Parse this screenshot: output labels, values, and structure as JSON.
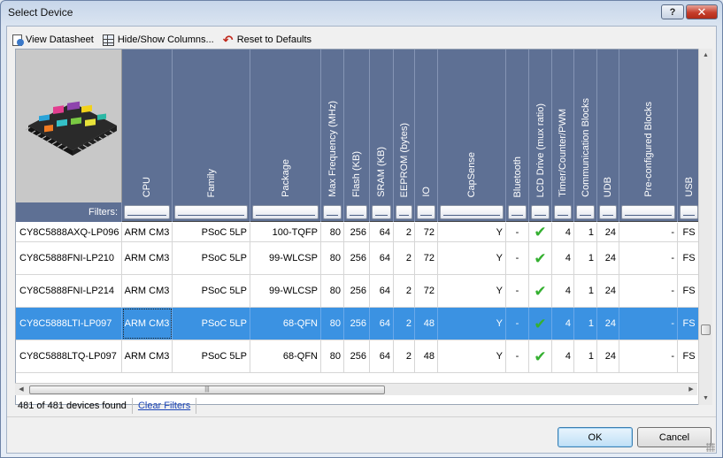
{
  "window": {
    "title": "Select Device",
    "help_label": "?",
    "close_label": "✕"
  },
  "toolbar": {
    "view_datasheet": "View Datasheet",
    "hide_show_columns": "Hide/Show Columns...",
    "reset_defaults": "Reset to Defaults"
  },
  "filters_label": "Filters:",
  "columns": [
    {
      "key": "cpu",
      "label": "CPU"
    },
    {
      "key": "family",
      "label": "Family"
    },
    {
      "key": "package",
      "label": "Package"
    },
    {
      "key": "max_freq",
      "label": "Max Frequency (MHz)"
    },
    {
      "key": "flash",
      "label": "Flash (KB)"
    },
    {
      "key": "sram",
      "label": "SRAM (KB)"
    },
    {
      "key": "eeprom",
      "label": "EEPROM (bytes)"
    },
    {
      "key": "io",
      "label": "IO"
    },
    {
      "key": "capsense",
      "label": "CapSense"
    },
    {
      "key": "bluetooth",
      "label": "Bluetooth"
    },
    {
      "key": "lcd",
      "label": "LCD Drive (mux ratio)"
    },
    {
      "key": "timer",
      "label": "Timer/Counter/PWM"
    },
    {
      "key": "comm",
      "label": "Communication Blocks"
    },
    {
      "key": "udb",
      "label": "UDB"
    },
    {
      "key": "preconf",
      "label": "Pre-configured Blocks"
    },
    {
      "key": "usb",
      "label": "USB"
    }
  ],
  "rows": [
    {
      "name": "CY8C5888AXQ-LP096",
      "cpu": "ARM CM3",
      "family": "PSoC 5LP",
      "package": "100-TQFP",
      "max_freq": "80",
      "flash": "256",
      "sram": "64",
      "eeprom": "2",
      "io": "72",
      "capsense": "Y",
      "bluetooth": "-",
      "lcd": "check",
      "timer": "4",
      "comm": "1",
      "udb": "24",
      "preconf": "-",
      "usb": "FS",
      "selected": false
    },
    {
      "name": "CY8C5888FNI-LP210",
      "cpu": "ARM CM3",
      "family": "PSoC 5LP",
      "package": "99-WLCSP",
      "max_freq": "80",
      "flash": "256",
      "sram": "64",
      "eeprom": "2",
      "io": "72",
      "capsense": "Y",
      "bluetooth": "-",
      "lcd": "check",
      "timer": "4",
      "comm": "1",
      "udb": "24",
      "preconf": "-",
      "usb": "FS",
      "selected": false
    },
    {
      "name": "CY8C5888FNI-LP214",
      "cpu": "ARM CM3",
      "family": "PSoC 5LP",
      "package": "99-WLCSP",
      "max_freq": "80",
      "flash": "256",
      "sram": "64",
      "eeprom": "2",
      "io": "72",
      "capsense": "Y",
      "bluetooth": "-",
      "lcd": "check",
      "timer": "4",
      "comm": "1",
      "udb": "24",
      "preconf": "-",
      "usb": "FS",
      "selected": false
    },
    {
      "name": "CY8C5888LTI-LP097",
      "cpu": "ARM CM3",
      "family": "PSoC 5LP",
      "package": "68-QFN",
      "max_freq": "80",
      "flash": "256",
      "sram": "64",
      "eeprom": "2",
      "io": "48",
      "capsense": "Y",
      "bluetooth": "-",
      "lcd": "check",
      "timer": "4",
      "comm": "1",
      "udb": "24",
      "preconf": "-",
      "usb": "FS",
      "selected": true
    },
    {
      "name": "CY8C5888LTQ-LP097",
      "cpu": "ARM CM3",
      "family": "PSoC 5LP",
      "package": "68-QFN",
      "max_freq": "80",
      "flash": "256",
      "sram": "64",
      "eeprom": "2",
      "io": "48",
      "capsense": "Y",
      "bluetooth": "-",
      "lcd": "check",
      "timer": "4",
      "comm": "1",
      "udb": "24",
      "preconf": "-",
      "usb": "FS",
      "selected": false
    }
  ],
  "status": {
    "count_text": "481 of 481 devices found",
    "clear_filters": "Clear Filters"
  },
  "buttons": {
    "ok": "OK",
    "cancel": "Cancel"
  },
  "colors": {
    "header_bg": "#5e7094",
    "selected_row": "#3b92e2",
    "check": "#35b031",
    "link": "#1a44b8"
  }
}
